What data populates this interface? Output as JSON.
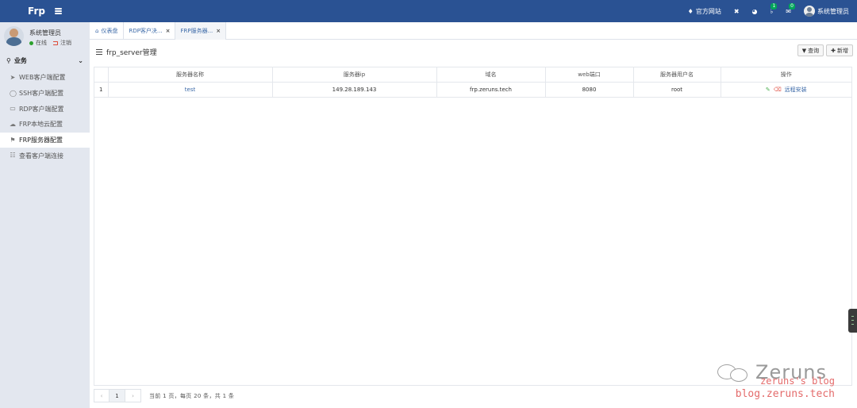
{
  "app": {
    "title": "Frp"
  },
  "header": {
    "items": [
      {
        "label": "官方网站",
        "icon": "diamond-icon"
      },
      {
        "label": "",
        "icon": "fullscreen-icon"
      },
      {
        "label": "",
        "icon": "dashboard-icon"
      },
      {
        "label": "",
        "icon": "bell-icon",
        "badge": "1"
      },
      {
        "label": "",
        "icon": "envelope-icon",
        "badge": "0"
      }
    ],
    "user": "系统管理员"
  },
  "sidebar": {
    "user": {
      "name": "系统管理员",
      "status_online": "在线",
      "status_logout": "注销"
    },
    "section": "业务",
    "items": [
      {
        "label": "WEB客户端配置",
        "icon": "send-icon"
      },
      {
        "label": "SSH客户端配置",
        "icon": "globe-icon"
      },
      {
        "label": "RDP客户端配置",
        "icon": "monitor-icon"
      },
      {
        "label": "FRP本地云配置",
        "icon": "cloud-icon"
      },
      {
        "label": "FRP服务器配置",
        "icon": "flag-icon"
      },
      {
        "label": "查看客户端连接",
        "icon": "sitemap-icon"
      }
    ],
    "active_index": 4
  },
  "tabs": [
    {
      "label": "仪表盘"
    },
    {
      "label": "RDP客户决..."
    },
    {
      "label": "FRP服务器..."
    }
  ],
  "content": {
    "title": "frp_server管理",
    "buttons": {
      "search": "查询",
      "add": "新增"
    },
    "columns": [
      "",
      "服务器名称",
      "服务器ip",
      "域名",
      "web端口",
      "服务器用户名",
      "操作"
    ],
    "rows": [
      {
        "index": "1",
        "name": "test",
        "ip": "149.28.189.143",
        "domain": "frp.zeruns.tech",
        "port": "8080",
        "user": "root",
        "action": "远程安装"
      }
    ],
    "pager": {
      "prev": "‹",
      "current": "1",
      "next": "›",
      "info": "当前 1 页，每页 20 条，共 1 条"
    }
  },
  "watermark": {
    "name": "Zeruns",
    "line1": "zeruns's blog",
    "line2": "blog.zeruns.tech"
  }
}
